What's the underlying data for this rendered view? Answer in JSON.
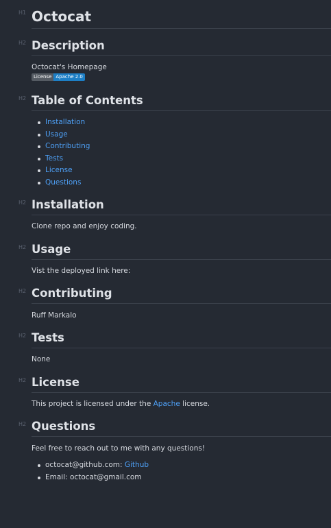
{
  "heading_marker_h1": "H1",
  "heading_marker_h2": "H2",
  "title": "Octocat",
  "description": {
    "heading": "Description",
    "text": "Octocat's Homepage",
    "badge_label": "License",
    "badge_value": "Apache 2.0"
  },
  "toc": {
    "heading": "Table of Contents",
    "items": [
      "Installation",
      "Usage",
      "Contributing",
      "Tests",
      "License",
      "Questions"
    ]
  },
  "installation": {
    "heading": "Installation",
    "text": "Clone repo and enjoy coding."
  },
  "usage": {
    "heading": "Usage",
    "text": "Vist the deployed link here:"
  },
  "contributing": {
    "heading": "Contributing",
    "text": "Ruff Markalo"
  },
  "tests": {
    "heading": "Tests",
    "text": "None"
  },
  "license": {
    "heading": "License",
    "text_before": "This project is licensed under the ",
    "link_text": "Apache",
    "text_after": " license."
  },
  "questions": {
    "heading": "Questions",
    "text": "Feel free to reach out to me with any questions!",
    "github_label": "octocat@github.com: ",
    "github_link": "Github",
    "email_label": "Email: octocat@gmail.com"
  },
  "colors": {
    "background": "#252a33",
    "link": "#4ea0f6",
    "badge_left": "#555b63",
    "badge_right": "#1d7fc6"
  }
}
